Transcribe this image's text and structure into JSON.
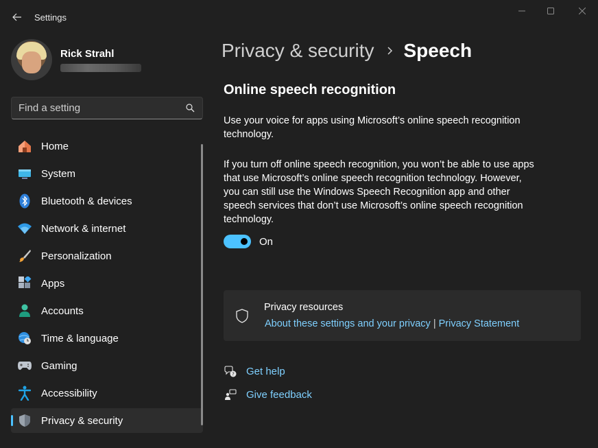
{
  "window": {
    "title": "Settings"
  },
  "profile": {
    "name": "Rick Strahl"
  },
  "search": {
    "placeholder": "Find a setting"
  },
  "sidebar": {
    "items": [
      {
        "label": "Home",
        "icon": "home-icon"
      },
      {
        "label": "System",
        "icon": "system-icon"
      },
      {
        "label": "Bluetooth & devices",
        "icon": "bluetooth-icon"
      },
      {
        "label": "Network & internet",
        "icon": "wifi-icon"
      },
      {
        "label": "Personalization",
        "icon": "brush-icon"
      },
      {
        "label": "Apps",
        "icon": "apps-icon"
      },
      {
        "label": "Accounts",
        "icon": "accounts-icon"
      },
      {
        "label": "Time & language",
        "icon": "globe-clock-icon"
      },
      {
        "label": "Gaming",
        "icon": "gamepad-icon"
      },
      {
        "label": "Accessibility",
        "icon": "accessibility-icon"
      },
      {
        "label": "Privacy & security",
        "icon": "shield-icon",
        "selected": true
      }
    ]
  },
  "breadcrumb": {
    "parent": "Privacy & security",
    "current": "Speech"
  },
  "main": {
    "section_title": "Online speech recognition",
    "description1": "Use your voice for apps using Microsoft’s online speech recognition technology.",
    "description2": "If you turn off online speech recognition, you won’t be able to use apps that use Microsoft’s online speech recognition technology. However, you can still use the Windows Speech Recognition app and other speech services that don’t use Microsoft’s online speech recognition technology.",
    "toggle": {
      "state": "On"
    },
    "resources": {
      "title": "Privacy resources",
      "link1": "About these settings and your privacy",
      "separator": "|",
      "link2": "Privacy Statement"
    },
    "help": {
      "get_help": "Get help",
      "give_feedback": "Give feedback"
    }
  },
  "colors": {
    "background": "#202020",
    "accent": "#4cc2ff",
    "link": "#7fd0ff"
  }
}
